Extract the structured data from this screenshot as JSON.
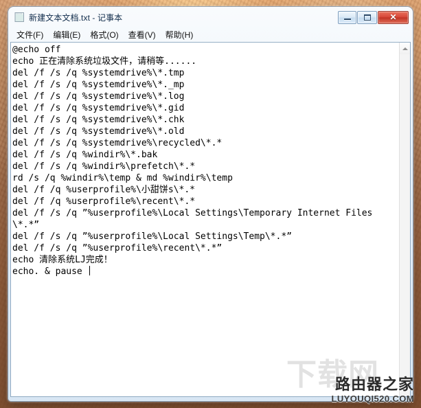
{
  "window": {
    "title": "新建文本文档.txt - 记事本",
    "icon": "notepad-icon",
    "caption_buttons": {
      "minimize_label": "–",
      "maximize_label": "□",
      "close_label": "✕"
    }
  },
  "menubar": {
    "items": [
      {
        "label": "文件(F)"
      },
      {
        "label": "编辑(E)"
      },
      {
        "label": "格式(O)"
      },
      {
        "label": "查看(V)"
      },
      {
        "label": "帮助(H)"
      }
    ]
  },
  "editor": {
    "lines": [
      "@echo off",
      "echo 正在清除系统垃圾文件，请稍等......",
      "del /f /s /q %systemdrive%\\*.tmp",
      "del /f /s /q %systemdrive%\\*._mp",
      "del /f /s /q %systemdrive%\\*.log",
      "del /f /s /q %systemdrive%\\*.gid",
      "del /f /s /q %systemdrive%\\*.chk",
      "del /f /s /q %systemdrive%\\*.old",
      "del /f /s /q %systemdrive%\\recycled\\*.*",
      "del /f /s /q %windir%\\*.bak",
      "del /f /s /q %windir%\\prefetch\\*.*",
      "rd /s /q %windir%\\temp & md %windir%\\temp",
      "del /f /q %userprofile%\\小甜饼s\\*.*",
      "del /f /q %userprofile%\\recent\\*.*",
      "del /f /s /q ”%userprofile%\\Local Settings\\Temporary Internet Files",
      "\\*.*”",
      "del /f /s /q ”%userprofile%\\Local Settings\\Temp\\*.*”",
      "del /f /s /q ”%userprofile%\\recent\\*.*”",
      "echo 清除系统LJ完成！",
      "echo. & pause "
    ],
    "cursor_line_index": 19
  },
  "scrollbar": {
    "up_arrow": "scroll-up-arrow",
    "down_arrow": "scroll-down-arrow"
  },
  "watermark": {
    "ghost": "下载网",
    "main": "路由器之家",
    "sub": "LUYOUQI520.COM"
  },
  "colors": {
    "accent": "#2d4a68",
    "close_button": "#c13425",
    "text": "#000000",
    "client_background": "#ffffff"
  }
}
